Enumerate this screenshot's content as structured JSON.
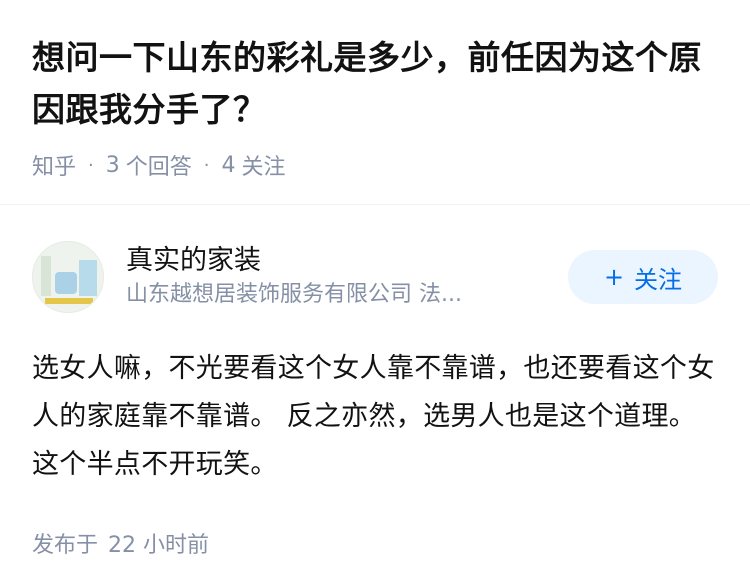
{
  "question": {
    "title": "想问一下山东的彩礼是多少，前任因为这个原因跟我分手了？",
    "source": "知乎",
    "answer_count": "3",
    "answer_label": "个回答",
    "follower_count": "4",
    "follower_label": "关注"
  },
  "answer": {
    "author_name": "真实的家装",
    "author_bio": "山东越想居装饰服务有限公司 法...",
    "follow_label": "关注",
    "content": "选女人嘛，不光要看这个女人靠不靠谱，也还要看这个女人的家庭靠不靠谱。 反之亦然，选男人也是这个道理。 这个半点不开玩笑。",
    "publish_label": "发布于",
    "publish_time": "22 小时前"
  },
  "colors": {
    "meta": "#8590a6",
    "accent": "#056de8",
    "button_bg": "#ebf5ff"
  }
}
